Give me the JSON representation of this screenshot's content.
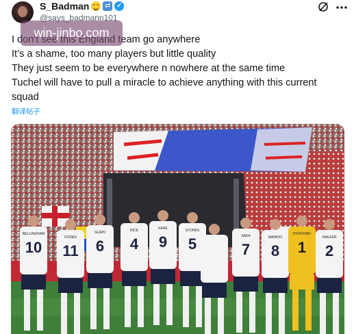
{
  "user": {
    "display_name": "S_Badman",
    "handle": "@says_badmann101",
    "verified": true
  },
  "header_icons": [
    "grok-slash-icon",
    "more-icon"
  ],
  "watermark": {
    "text": "win-jinbo.com"
  },
  "tweet": {
    "lines": [
      "I don't see this England team go anywhere",
      "It’s a shame, too many players but little quality",
      "They just seem to be everywhere n nowhere at the same time",
      "Tuchel will have to pull a miracle to achieve anything with this current",
      "squad"
    ],
    "translate_label": "翻译帖子"
  },
  "photo": {
    "description_colors": {
      "banner": "#3c57c9",
      "kit": "#f4f4f4",
      "shorts": "#1c2340",
      "keeper": "#f0c020",
      "pitch": "#3f7f3a"
    },
    "players": [
      {
        "name": "BELLINGHAM",
        "number": "10"
      },
      {
        "name": "FODEN",
        "number": "11"
      },
      {
        "name": "GUEHI",
        "number": "6"
      },
      {
        "name": "RICE",
        "number": "4"
      },
      {
        "name": "KANE",
        "number": "9"
      },
      {
        "name": "STONES",
        "number": "5"
      },
      {
        "name": "",
        "number": ""
      },
      {
        "name": "SAKA",
        "number": "7"
      },
      {
        "name": "MAINOO",
        "number": "8"
      },
      {
        "name": "PICKFORD",
        "number": "1"
      },
      {
        "name": "WALKER",
        "number": "2"
      }
    ]
  }
}
